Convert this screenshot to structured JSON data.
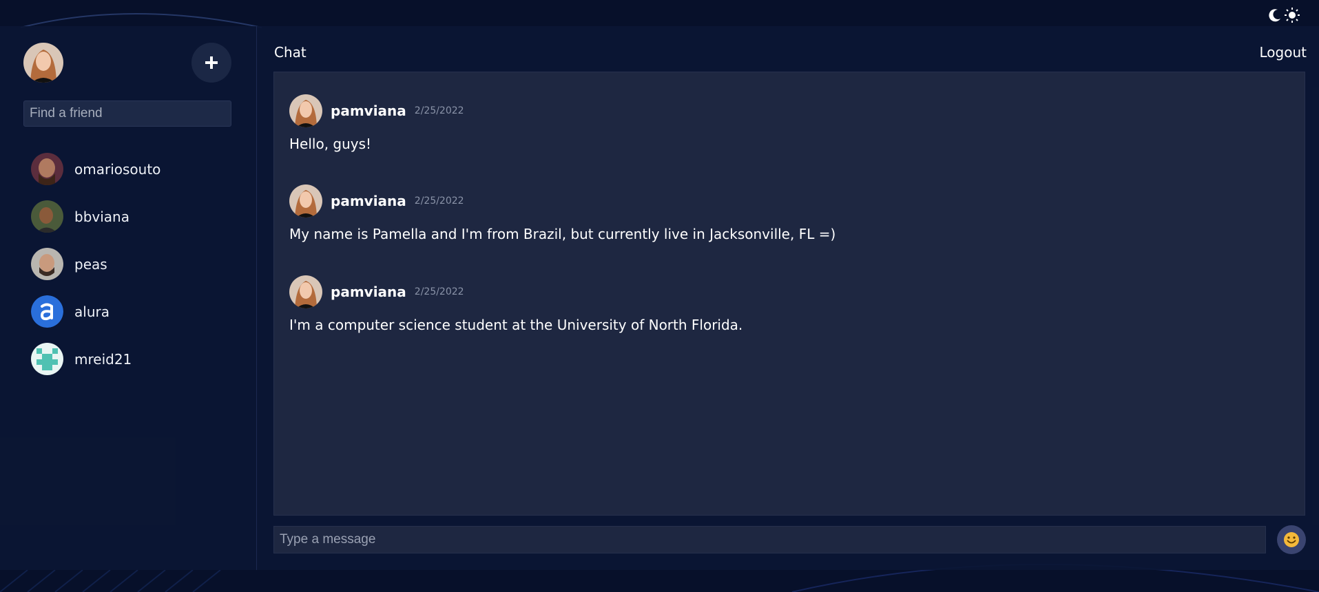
{
  "sidebar": {
    "search_placeholder": "Find a friend",
    "friends": [
      {
        "name": "omariosouto"
      },
      {
        "name": "bbviana"
      },
      {
        "name": "peas"
      },
      {
        "name": "alura"
      },
      {
        "name": "mreid21"
      }
    ]
  },
  "header": {
    "title": "Chat",
    "logout_label": "Logout"
  },
  "messages": [
    {
      "user": "pamviana",
      "date": "2/25/2022",
      "text": "Hello, guys!"
    },
    {
      "user": "pamviana",
      "date": "2/25/2022",
      "text": "My name is Pamella and I'm from Brazil, but currently live in Jacksonville, FL =)"
    },
    {
      "user": "pamviana",
      "date": "2/25/2022",
      "text": "I'm a computer science student at the University of North Florida."
    }
  ],
  "composer": {
    "placeholder": "Type a message"
  },
  "icons": {
    "theme_toggle": "moon-sun-icon",
    "add": "plus-icon",
    "emoji": "smiley-emoji-icon"
  },
  "colors": {
    "background": "#07102a",
    "panel": "#1e2741",
    "input": "#1d2947"
  }
}
